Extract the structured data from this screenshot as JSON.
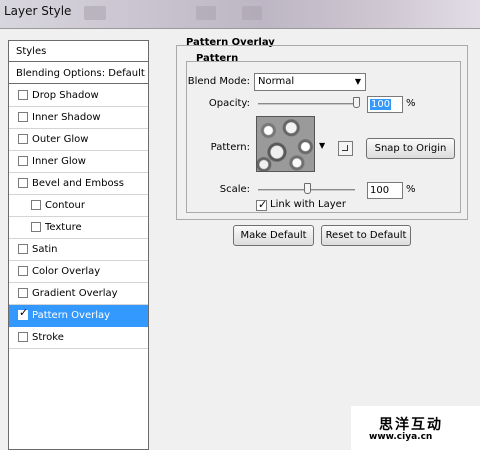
{
  "window": {
    "title": "Layer Style"
  },
  "styles_panel": {
    "header": "Styles",
    "blending_options": "Blending Options: Default",
    "items": [
      {
        "label": "Drop Shadow",
        "checked": false,
        "indent": false,
        "selected": false
      },
      {
        "label": "Inner Shadow",
        "checked": false,
        "indent": false,
        "selected": false
      },
      {
        "label": "Outer Glow",
        "checked": false,
        "indent": false,
        "selected": false
      },
      {
        "label": "Inner Glow",
        "checked": false,
        "indent": false,
        "selected": false
      },
      {
        "label": "Bevel and Emboss",
        "checked": false,
        "indent": false,
        "selected": false
      },
      {
        "label": "Contour",
        "checked": false,
        "indent": true,
        "selected": false
      },
      {
        "label": "Texture",
        "checked": false,
        "indent": true,
        "selected": false
      },
      {
        "label": "Satin",
        "checked": false,
        "indent": false,
        "selected": false
      },
      {
        "label": "Color Overlay",
        "checked": false,
        "indent": false,
        "selected": false
      },
      {
        "label": "Gradient Overlay",
        "checked": false,
        "indent": false,
        "selected": false
      },
      {
        "label": "Pattern Overlay",
        "checked": true,
        "indent": false,
        "selected": true
      },
      {
        "label": "Stroke",
        "checked": false,
        "indent": false,
        "selected": false
      }
    ]
  },
  "pattern_overlay": {
    "section_title": "Pattern Overlay",
    "group_title": "Pattern",
    "blend_mode_label": "Blend Mode:",
    "blend_mode_value": "Normal",
    "opacity_label": "Opacity:",
    "opacity_value": "100",
    "opacity_unit": "%",
    "opacity_fraction": 1.0,
    "pattern_label": "Pattern:",
    "snap_button": "Snap to Origin",
    "scale_label": "Scale:",
    "scale_value": "100",
    "scale_unit": "%",
    "scale_fraction": 0.5,
    "link_label": "Link with Layer",
    "link_checked": true,
    "make_default": "Make Default",
    "reset_default": "Reset to Default"
  },
  "watermark": {
    "text_cn": "思洋互动",
    "url": "www.ciya.cn"
  },
  "colors": {
    "selection": "#3399ff",
    "panel_bg": "#f0f0f0"
  },
  "icons": {
    "dropdown": "triangle-down-icon",
    "check": "check-mark-icon",
    "new_preset": "new-preset-icon"
  }
}
